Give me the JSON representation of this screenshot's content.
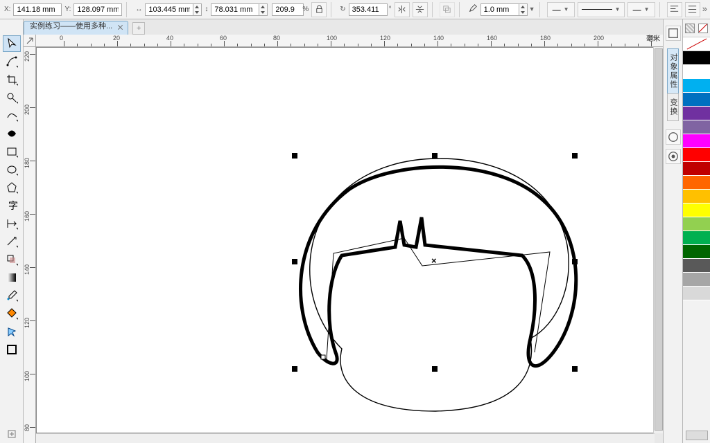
{
  "props": {
    "x_label": "X:",
    "x": "141.18 mm",
    "y_label": "Y:",
    "y": "128.097 mm",
    "w": "103.445 mm",
    "h": "78.031 mm",
    "sx": "209.9",
    "sy": "209.9",
    "pct": "%",
    "rot": "353.411",
    "deg": "°",
    "outline": "1.0 mm"
  },
  "tab": {
    "title": "实例练习——使用多种...",
    "new": "+"
  },
  "ruler": {
    "unit": "毫米"
  },
  "dock": {
    "t1": "对象属性",
    "t2": "变换"
  },
  "palette": [
    "#000000",
    "#FFFFFF",
    "#00B0F0",
    "#0070C0",
    "#7030A0",
    "#8064A2",
    "#FF00FF",
    "#FF0000",
    "#C00000",
    "#FF6600",
    "#FFC000",
    "#FFFF00",
    "#92D050",
    "#00B050",
    "#006600",
    "#595959",
    "#A6A6A6",
    "#D9D9D9"
  ]
}
